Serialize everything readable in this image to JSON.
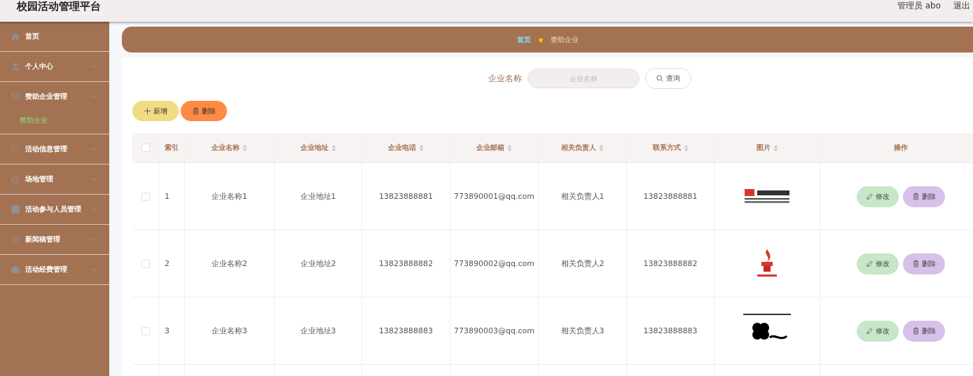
{
  "header": {
    "title": "校园活动管理平台",
    "user": "管理员 abo",
    "logout": "退出"
  },
  "sidebar": {
    "items": [
      {
        "label": "首页",
        "has_children": false
      },
      {
        "label": "个人中心",
        "has_children": true,
        "expanded": false
      },
      {
        "label": "赞助企业管理",
        "has_children": true,
        "expanded": true,
        "children": [
          {
            "label": "赞助企业",
            "selected": true
          }
        ]
      },
      {
        "label": "活动信息管理",
        "has_children": true,
        "expanded": false
      },
      {
        "label": "场地管理",
        "has_children": true,
        "expanded": false
      },
      {
        "label": "活动参与人员管理",
        "has_children": true,
        "expanded": false
      },
      {
        "label": "新闻稿管理",
        "has_children": true,
        "expanded": false
      },
      {
        "label": "活动经费管理",
        "has_children": true,
        "expanded": false
      }
    ]
  },
  "breadcrumb": [
    "首页",
    "赞助企业"
  ],
  "search": {
    "label": "企业名称",
    "placeholder": "企业名称",
    "button": "查询"
  },
  "actions": {
    "add": "新增",
    "delete": "删除"
  },
  "table": {
    "select_all_checked": false,
    "columns": [
      {
        "label": "索引",
        "sortable": false
      },
      {
        "label": "企业名称",
        "sortable": true
      },
      {
        "label": "企业地址",
        "sortable": true
      },
      {
        "label": "企业电话",
        "sortable": true
      },
      {
        "label": "企业邮箱",
        "sortable": true
      },
      {
        "label": "相关负责人",
        "sortable": true
      },
      {
        "label": "联系方式",
        "sortable": true
      },
      {
        "label": "图片",
        "sortable": true
      },
      {
        "label": "操作",
        "sortable": false
      }
    ],
    "rows": [
      {
        "checked": false,
        "cells": [
          "1",
          "企业名称1",
          "企业地址1",
          "13823888881",
          "773890001@qq.com",
          "相关负责人1",
          "13823888881"
        ],
        "picture": {
          "kind": "picture"
        },
        "edit": "修改",
        "delete": "删除"
      },
      {
        "checked": false,
        "cells": [
          "2",
          "企业名称2",
          "企业地址2",
          "13823888882",
          "773890002@qq.com",
          "相关负责人2",
          "13823888882"
        ],
        "picture": {
          "kind": "picture"
        },
        "edit": "修改",
        "delete": "删除"
      },
      {
        "checked": false,
        "cells": [
          "3",
          "企业名称3",
          "企业地址3",
          "13823888883",
          "773890003@qq.com",
          "相关负责人3",
          "13823888883"
        ],
        "picture": {
          "kind": "picture"
        },
        "edit": "修改",
        "delete": "删除"
      }
    ]
  }
}
